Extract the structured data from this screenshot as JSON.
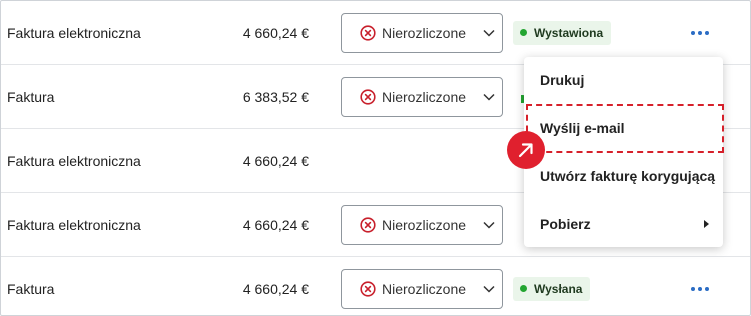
{
  "rows": [
    {
      "type": "Faktura elektroniczna",
      "amount": "4 660,24 €",
      "payment": "Nierozliczone",
      "status": "Wystawiona"
    },
    {
      "type": "Faktura",
      "amount": "6 383,52 €",
      "payment": "Nierozliczone"
    },
    {
      "type": "Faktura elektroniczna",
      "amount": "4 660,24 €"
    },
    {
      "type": "Faktura elektroniczna",
      "amount": "4 660,24 €",
      "payment": "Nierozliczone"
    },
    {
      "type": "Faktura",
      "amount": "4 660,24 €",
      "payment": "Nierozliczone",
      "status": "Wysłana"
    }
  ],
  "menu": {
    "items": [
      {
        "label": "Drukuj"
      },
      {
        "label": "Wyślij e-mail",
        "highlighted": true
      },
      {
        "label": "Utwórz fakturę korygującą"
      },
      {
        "label": "Pobierz",
        "has_submenu": true
      }
    ]
  },
  "icons": {
    "payment": "close-circle-icon",
    "dropdown": "chevron-down-icon",
    "more": "more-horizontal-icon",
    "submenu": "caret-right-icon",
    "pointer": "arrow-up-right-icon"
  },
  "colors": {
    "accent": "#2b6cc4",
    "status_dot": "#23a531",
    "status_bg": "#eaf5ea",
    "unpaid_icon": "#c8202c",
    "highlight": "#d6202a",
    "pointer_badge": "#e0202e"
  }
}
